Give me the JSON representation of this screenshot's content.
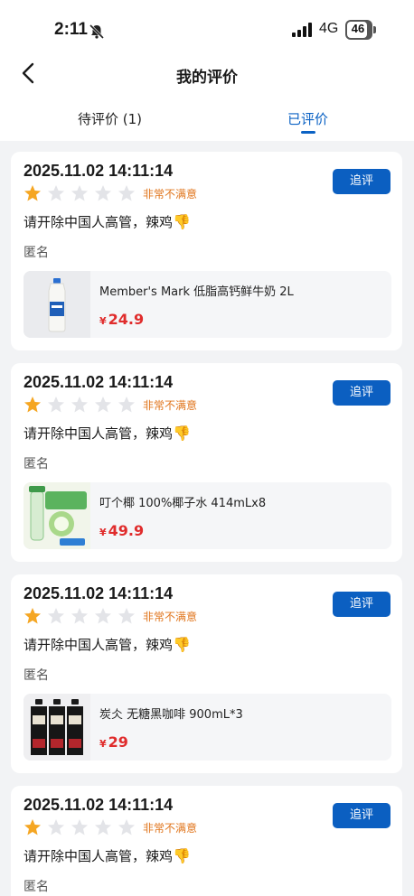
{
  "status_bar": {
    "time": "2:11",
    "network": "4G",
    "battery": "46",
    "icons": [
      "bell-slash-icon",
      "signal-icon",
      "battery-icon"
    ]
  },
  "header": {
    "title": "我的评价"
  },
  "tabs": [
    {
      "label": "待评价 (1)",
      "active": false
    },
    {
      "label": "已评价",
      "active": true
    }
  ],
  "colors": {
    "accent": "#0b62c4",
    "price": "#e02c2c",
    "rating_label": "#e0751c",
    "star_filled": "#f5a623",
    "star_empty": "#e3e4e8"
  },
  "reviews": [
    {
      "date": "2025.11.02 14:11:14",
      "rating": 1,
      "rating_label": "非常不满意",
      "followup_label": "追评",
      "text": "请开除中国人高管，辣鸡",
      "author": "匿名",
      "product": {
        "name": "Member's Mark 低脂高钙鲜牛奶 2L",
        "price": "24.9",
        "currency": "¥",
        "image": "milk-bottle"
      }
    },
    {
      "date": "2025.11.02 14:11:14",
      "rating": 1,
      "rating_label": "非常不满意",
      "followup_label": "追评",
      "text": "请开除中国人高管，辣鸡",
      "author": "匿名",
      "product": {
        "name": "叮个椰 100%椰子水 414mLx8",
        "price": "49.9",
        "currency": "¥",
        "image": "coconut-water"
      }
    },
    {
      "date": "2025.11.02 14:11:14",
      "rating": 1,
      "rating_label": "非常不满意",
      "followup_label": "追评",
      "text": "请开除中国人高管，辣鸡",
      "author": "匿名",
      "product": {
        "name": "炭仌 无糖黑咖啡  900mL*3",
        "price": "29",
        "currency": "¥",
        "image": "coffee-bottles"
      }
    },
    {
      "date": "2025.11.02 14:11:14",
      "rating": 1,
      "rating_label": "非常不满意",
      "followup_label": "追评",
      "text": "请开除中国人高管，辣鸡",
      "author": "匿名"
    }
  ]
}
